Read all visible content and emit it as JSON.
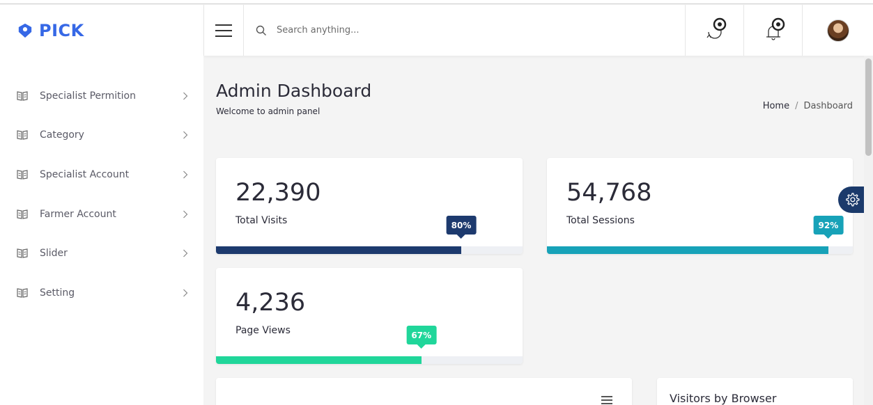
{
  "brand": {
    "name": "PICK",
    "color": "#3668e6"
  },
  "header": {
    "search_placeholder": "Search anything...",
    "icons": [
      "menu-icon",
      "search-icon",
      "sync-icon",
      "bell-icon",
      "avatar"
    ]
  },
  "sidebar": {
    "items": [
      {
        "label": "Specialist Permition",
        "icon": "book-icon"
      },
      {
        "label": "Category",
        "icon": "book-icon"
      },
      {
        "label": "Specialist Account",
        "icon": "book-icon"
      },
      {
        "label": "Farmer Account",
        "icon": "book-icon"
      },
      {
        "label": "Slider",
        "icon": "book-icon"
      },
      {
        "label": "Setting",
        "icon": "book-icon"
      }
    ]
  },
  "page": {
    "title": "Admin Dashboard",
    "subtitle": "Welcome to admin panel",
    "breadcrumb": {
      "home": "Home",
      "separator": "/",
      "current": "Dashboard"
    }
  },
  "stats": [
    {
      "value": "22,390",
      "label": "Total Visits",
      "percent_label": "80%",
      "percent": 80,
      "color": "#1d3a6e"
    },
    {
      "value": "54,768",
      "label": "Total Sessions",
      "percent_label": "92%",
      "percent": 92,
      "color": "#17a2b8"
    },
    {
      "value": "4,236",
      "label": "Page Views",
      "percent_label": "67%",
      "percent": 67,
      "color": "#20d69a"
    }
  ],
  "panels": {
    "browser_title": "Visitors by Browser"
  }
}
